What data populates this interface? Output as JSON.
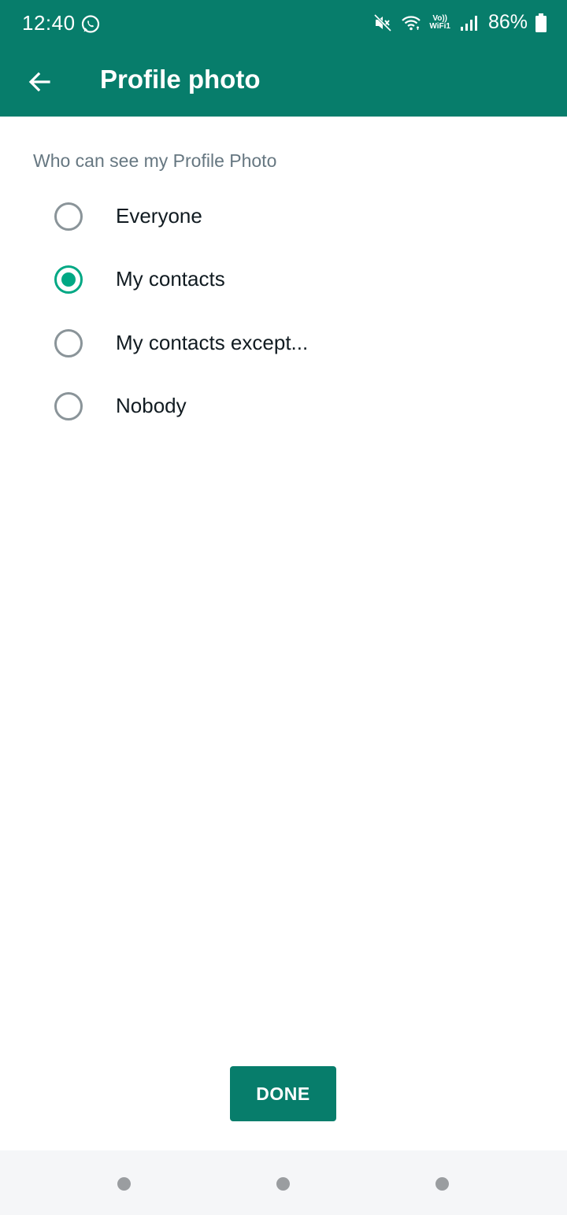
{
  "status_bar": {
    "time": "12:40",
    "volte_line1": "Vo))",
    "volte_line2": "WiFi1",
    "battery": "86%",
    "icons": [
      "whatsapp-icon",
      "mute-icon",
      "wifi-icon",
      "volte-wifi-icon",
      "signal-icon",
      "battery-icon"
    ]
  },
  "app_bar": {
    "title": "Profile photo",
    "back_icon": "arrow-left-icon"
  },
  "section_label": "Who can see my Profile Photo",
  "options": [
    {
      "label": "Everyone",
      "checked": false
    },
    {
      "label": "My contacts",
      "checked": true
    },
    {
      "label": "My contacts except...",
      "checked": false
    },
    {
      "label": "Nobody",
      "checked": false
    }
  ],
  "done_label": "DONE",
  "colors": {
    "brand": "#077d6b",
    "accent": "#00a884",
    "radio_unchecked": "#8a9499",
    "label_gray": "#667781"
  }
}
